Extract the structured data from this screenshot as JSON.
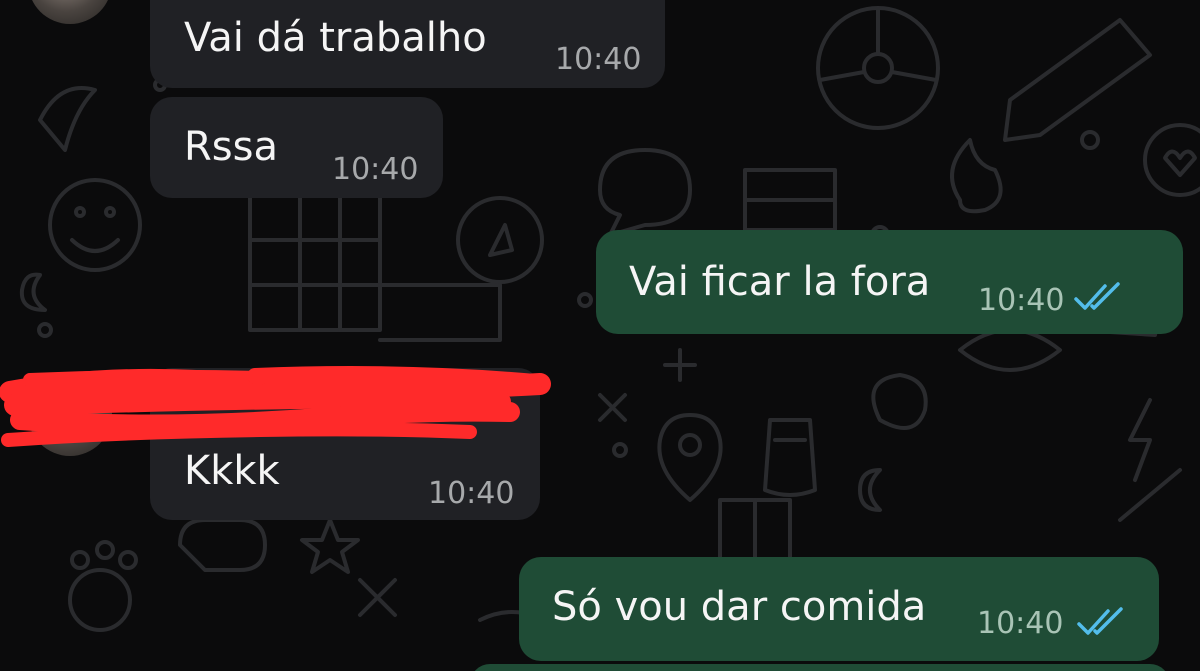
{
  "colors": {
    "background": "#0b0b0c",
    "incoming_bubble": "#202125",
    "outgoing_bubble": "#1f4c36",
    "read_ticks": "#53bdeb",
    "redaction": "#ff2a2a"
  },
  "messages": [
    {
      "direction": "incoming",
      "text": "Vai dá trabalho",
      "time": "10:40"
    },
    {
      "direction": "incoming",
      "text": "Rssa",
      "time": "10:40"
    },
    {
      "direction": "outgoing",
      "text": "Vai ficar la fora",
      "time": "10:40",
      "status_icon": "double-check-read-icon"
    },
    {
      "direction": "incoming",
      "text": "Kkkk",
      "time": "10:40"
    },
    {
      "direction": "outgoing",
      "text": "Só vou dar comida",
      "time": "10:40",
      "status_icon": "double-check-read-icon"
    }
  ]
}
